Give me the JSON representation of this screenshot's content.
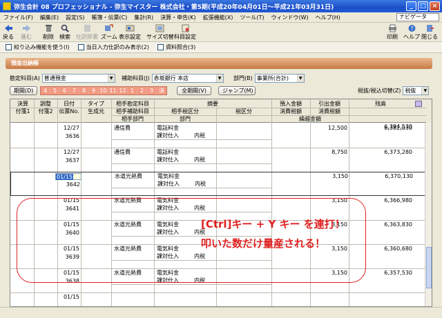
{
  "window": {
    "title": "弥生会計 08 プロフェッショナル - 弥生マイスター 株式会社・第5期(平成20年04月01日～平成21年03月31日)"
  },
  "menu": [
    "ファイル(F)",
    "編集(E)",
    "設定(S)",
    "帳簿・伝票(C)",
    "集計(R)",
    "決算・申告(K)",
    "拡張機能(X)",
    "ツール(T)",
    "ウィンドウ(W)",
    "ヘルプ(H)"
  ],
  "navi": "ナビゲータ",
  "toolbar": {
    "back": "戻る",
    "forward": "進む",
    "delete": "削除",
    "search": "検索",
    "display_settings_gray": "仕訳辞書",
    "zoom": "ズーム",
    "display_settings": "表示設定",
    "size_toggle": "サイズ切替",
    "account_settings": "科目設定",
    "print": "印刷",
    "help": "ヘルプ",
    "close": "閉じる"
  },
  "options": [
    "絞り込み機能を使う(I)",
    "当日入力仕訳のみ表示(2)",
    "資料照合(3)"
  ],
  "panel_title": "預金出納帳",
  "criteria": {
    "account_label": "勘定科目(A)",
    "account_value": "普通預金",
    "sub_label": "補助科目(J)",
    "sub_value": "赤坂銀行 本店",
    "dept_label": "部門(B)",
    "dept_value": "事業所(合計)"
  },
  "period": {
    "label": "期間(D)",
    "months": [
      "4",
      "5",
      "6",
      "7",
      "8",
      "9",
      "10",
      "11",
      "12",
      "1",
      "2",
      "3",
      "決"
    ],
    "all_button": "全期間(V)",
    "jump_button": "ジャンプ(M)",
    "tax_label": "税抜/税込切替(Z)",
    "tax_value": "税抜"
  },
  "header": {
    "r1": [
      "決算",
      "調整",
      "日付",
      "タイプ",
      "相手勘定科目",
      "摘要",
      "預入金額",
      "引出金額",
      "残高"
    ],
    "r2": [
      "付箋1",
      "付箋2",
      "伝票No.",
      "生成元",
      "相手補助科目",
      "相手税区分",
      "税区分",
      "消費税額",
      "消費税額"
    ],
    "r3": [
      "相手部門",
      "部門",
      "繰越金額"
    ],
    "carry": "6,394,530"
  },
  "rows": [
    {
      "date": "12/27",
      "no": "3636",
      "account": "通信費",
      "memo": "電話料金",
      "tax1": "課対仕入",
      "tax2": "内税",
      "deposit": "",
      "withdraw": "12,500",
      "balance": "6,382,030"
    },
    {
      "date": "12/27",
      "no": "3637",
      "account": "通信費",
      "memo": "電話料金",
      "tax1": "課対仕入",
      "tax2": "内税",
      "deposit": "",
      "withdraw": "8,750",
      "balance": "6,373,280"
    },
    {
      "date": "01/15",
      "no": "3642",
      "account": "水道光熱費",
      "memo": "電気料金",
      "tax1": "課対仕入",
      "tax2": "内税",
      "deposit": "",
      "withdraw": "3,150",
      "balance": "6,370,130"
    },
    {
      "date": "01/15",
      "no": "3641",
      "account": "水道光熱費",
      "memo": "電気料金",
      "tax1": "課対仕入",
      "tax2": "内税",
      "deposit": "",
      "withdraw": "3,150",
      "balance": "6,366,980"
    },
    {
      "date": "01/15",
      "no": "3640",
      "account": "水道光熱費",
      "memo": "電気料金",
      "tax1": "課対仕入",
      "tax2": "内税",
      "deposit": "",
      "withdraw": "3,150",
      "balance": "6,363,830"
    },
    {
      "date": "01/15",
      "no": "3639",
      "account": "水道光熱費",
      "memo": "電気料金",
      "tax1": "課対仕入",
      "tax2": "内税",
      "deposit": "",
      "withdraw": "3,150",
      "balance": "6,360,680"
    },
    {
      "date": "01/15",
      "no": "3638",
      "account": "水道光熱費",
      "memo": "電気料金",
      "tax1": "課対仕入",
      "tax2": "内税",
      "deposit": "",
      "withdraw": "3,150",
      "balance": "6,357,530"
    },
    {
      "date": "01/15",
      "no": "",
      "account": "",
      "memo": "",
      "tax1": "",
      "tax2": "",
      "deposit": "",
      "withdraw": "",
      "balance": ""
    }
  ],
  "edit_date": "01/15",
  "callout": {
    "line1": "[Ctrl]キー + Y キー を連打！",
    "line2": "叩いた数だけ量産される！"
  },
  "colors": {
    "accent": "#E02020",
    "title_blue": "#1B4FC8",
    "panel": "#C97A45"
  }
}
